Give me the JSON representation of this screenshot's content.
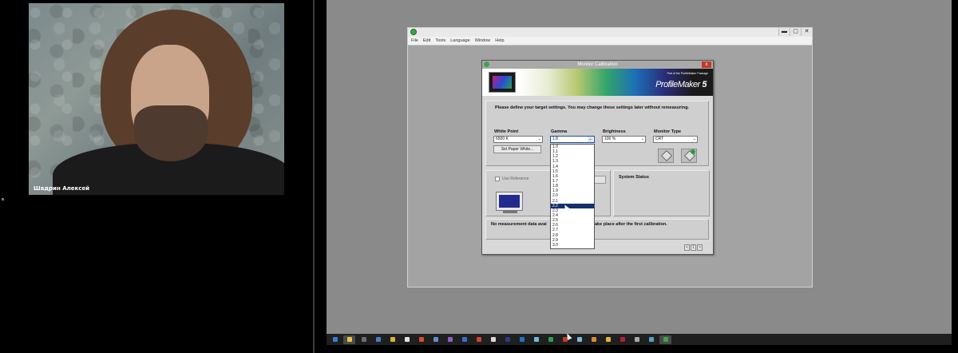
{
  "video": {
    "participant_name": "Шадрин Алексей"
  },
  "app_window": {
    "menu": [
      "File",
      "Edit",
      "Tools",
      "Language",
      "Window",
      "Help"
    ],
    "controls": {
      "minimize": "▬",
      "maximize": "▢",
      "close": "✕"
    }
  },
  "dialog": {
    "title": "Monitor Calibration",
    "close": "x",
    "banner": {
      "part_text": "Part of the ProfileMaker Package",
      "product": "ProfileMaker",
      "version": "5"
    },
    "instructions": "Please define your target settings. You may change these settings later without remeasuring.",
    "fields": {
      "white_point": {
        "label": "White Point",
        "value": "6500 K"
      },
      "gamma": {
        "label": "Gamma",
        "value": "1.8"
      },
      "brightness": {
        "label": "Brightness",
        "value": "100 %"
      },
      "monitor_type": {
        "label": "Monitor Type",
        "value": "CRT"
      }
    },
    "set_paper_white": "Set Paper White...",
    "use_reference": "Use Reference",
    "system_status": "System Status",
    "info_left": "No measurement data avai",
    "info_right": "ake place after the first calibration.",
    "nav": [
      "<",
      "1",
      ">"
    ]
  },
  "gamma_options": [
    "1.0",
    "1.1",
    "1.2",
    "1.3",
    "1.4",
    "1.5",
    "1.6",
    "1.7",
    "1.8",
    "1.9",
    "2.0",
    "2.1",
    "2.2",
    "2.3",
    "2.4",
    "2.5",
    "2.6",
    "2.7",
    "2.8",
    "2.9",
    "3.0"
  ],
  "gamma_highlighted": "2.2",
  "taskbar": [
    {
      "name": "windows-start-icon",
      "color": "#3a7bd5"
    },
    {
      "name": "file-explorer-icon",
      "color": "#e8c34a"
    },
    {
      "name": "app-icon-2",
      "color": "#6d6d6d"
    },
    {
      "name": "app-icon-3",
      "color": "#4a7cc7"
    },
    {
      "name": "app-icon-4",
      "color": "#d9b23a"
    },
    {
      "name": "app-icon-5",
      "color": "#e0e0e0"
    },
    {
      "name": "app-icon-6",
      "color": "#d64c2c"
    },
    {
      "name": "app-icon-7",
      "color": "#5f8fd1"
    },
    {
      "name": "app-icon-8",
      "color": "#8a5fc7"
    },
    {
      "name": "app-icon-9",
      "color": "#3b6fc7"
    },
    {
      "name": "app-icon-10",
      "color": "#c9472b"
    },
    {
      "name": "app-icon-11",
      "color": "#d8d8d8"
    },
    {
      "name": "app-icon-12",
      "color": "#2b3a8c"
    },
    {
      "name": "app-icon-13",
      "color": "#1e72c8"
    },
    {
      "name": "app-icon-14",
      "color": "#6fb7e0"
    },
    {
      "name": "app-icon-15",
      "color": "#2f9e48"
    },
    {
      "name": "app-icon-16",
      "color": "#c43a2a"
    },
    {
      "name": "app-icon-17",
      "color": "#7ab8e0"
    },
    {
      "name": "app-icon-18",
      "color": "#d78a3a"
    },
    {
      "name": "app-icon-19",
      "color": "#e0b33a"
    },
    {
      "name": "app-icon-20",
      "color": "#b0213a"
    },
    {
      "name": "app-icon-21",
      "color": "#a8a8a8"
    },
    {
      "name": "app-icon-22",
      "color": "#4fa3c7"
    },
    {
      "name": "profilemaker-taskbar-icon",
      "color": "#3fa34d"
    }
  ]
}
